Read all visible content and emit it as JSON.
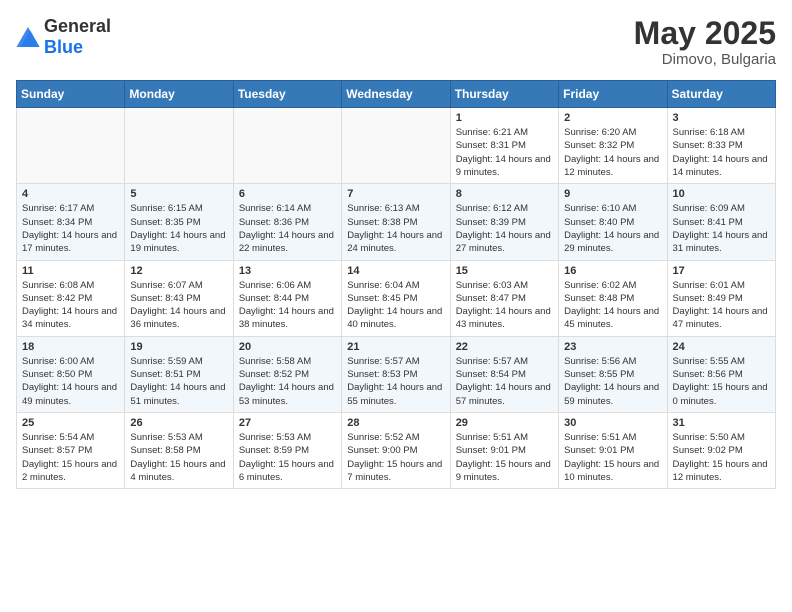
{
  "header": {
    "logo_general": "General",
    "logo_blue": "Blue",
    "month": "May 2025",
    "location": "Dimovo, Bulgaria"
  },
  "weekdays": [
    "Sunday",
    "Monday",
    "Tuesday",
    "Wednesday",
    "Thursday",
    "Friday",
    "Saturday"
  ],
  "weeks": [
    [
      {
        "day": "",
        "sunrise": "",
        "sunset": "",
        "daylight": ""
      },
      {
        "day": "",
        "sunrise": "",
        "sunset": "",
        "daylight": ""
      },
      {
        "day": "",
        "sunrise": "",
        "sunset": "",
        "daylight": ""
      },
      {
        "day": "",
        "sunrise": "",
        "sunset": "",
        "daylight": ""
      },
      {
        "day": "1",
        "sunrise": "Sunrise: 6:21 AM",
        "sunset": "Sunset: 8:31 PM",
        "daylight": "Daylight: 14 hours and 9 minutes."
      },
      {
        "day": "2",
        "sunrise": "Sunrise: 6:20 AM",
        "sunset": "Sunset: 8:32 PM",
        "daylight": "Daylight: 14 hours and 12 minutes."
      },
      {
        "day": "3",
        "sunrise": "Sunrise: 6:18 AM",
        "sunset": "Sunset: 8:33 PM",
        "daylight": "Daylight: 14 hours and 14 minutes."
      }
    ],
    [
      {
        "day": "4",
        "sunrise": "Sunrise: 6:17 AM",
        "sunset": "Sunset: 8:34 PM",
        "daylight": "Daylight: 14 hours and 17 minutes."
      },
      {
        "day": "5",
        "sunrise": "Sunrise: 6:15 AM",
        "sunset": "Sunset: 8:35 PM",
        "daylight": "Daylight: 14 hours and 19 minutes."
      },
      {
        "day": "6",
        "sunrise": "Sunrise: 6:14 AM",
        "sunset": "Sunset: 8:36 PM",
        "daylight": "Daylight: 14 hours and 22 minutes."
      },
      {
        "day": "7",
        "sunrise": "Sunrise: 6:13 AM",
        "sunset": "Sunset: 8:38 PM",
        "daylight": "Daylight: 14 hours and 24 minutes."
      },
      {
        "day": "8",
        "sunrise": "Sunrise: 6:12 AM",
        "sunset": "Sunset: 8:39 PM",
        "daylight": "Daylight: 14 hours and 27 minutes."
      },
      {
        "day": "9",
        "sunrise": "Sunrise: 6:10 AM",
        "sunset": "Sunset: 8:40 PM",
        "daylight": "Daylight: 14 hours and 29 minutes."
      },
      {
        "day": "10",
        "sunrise": "Sunrise: 6:09 AM",
        "sunset": "Sunset: 8:41 PM",
        "daylight": "Daylight: 14 hours and 31 minutes."
      }
    ],
    [
      {
        "day": "11",
        "sunrise": "Sunrise: 6:08 AM",
        "sunset": "Sunset: 8:42 PM",
        "daylight": "Daylight: 14 hours and 34 minutes."
      },
      {
        "day": "12",
        "sunrise": "Sunrise: 6:07 AM",
        "sunset": "Sunset: 8:43 PM",
        "daylight": "Daylight: 14 hours and 36 minutes."
      },
      {
        "day": "13",
        "sunrise": "Sunrise: 6:06 AM",
        "sunset": "Sunset: 8:44 PM",
        "daylight": "Daylight: 14 hours and 38 minutes."
      },
      {
        "day": "14",
        "sunrise": "Sunrise: 6:04 AM",
        "sunset": "Sunset: 8:45 PM",
        "daylight": "Daylight: 14 hours and 40 minutes."
      },
      {
        "day": "15",
        "sunrise": "Sunrise: 6:03 AM",
        "sunset": "Sunset: 8:47 PM",
        "daylight": "Daylight: 14 hours and 43 minutes."
      },
      {
        "day": "16",
        "sunrise": "Sunrise: 6:02 AM",
        "sunset": "Sunset: 8:48 PM",
        "daylight": "Daylight: 14 hours and 45 minutes."
      },
      {
        "day": "17",
        "sunrise": "Sunrise: 6:01 AM",
        "sunset": "Sunset: 8:49 PM",
        "daylight": "Daylight: 14 hours and 47 minutes."
      }
    ],
    [
      {
        "day": "18",
        "sunrise": "Sunrise: 6:00 AM",
        "sunset": "Sunset: 8:50 PM",
        "daylight": "Daylight: 14 hours and 49 minutes."
      },
      {
        "day": "19",
        "sunrise": "Sunrise: 5:59 AM",
        "sunset": "Sunset: 8:51 PM",
        "daylight": "Daylight: 14 hours and 51 minutes."
      },
      {
        "day": "20",
        "sunrise": "Sunrise: 5:58 AM",
        "sunset": "Sunset: 8:52 PM",
        "daylight": "Daylight: 14 hours and 53 minutes."
      },
      {
        "day": "21",
        "sunrise": "Sunrise: 5:57 AM",
        "sunset": "Sunset: 8:53 PM",
        "daylight": "Daylight: 14 hours and 55 minutes."
      },
      {
        "day": "22",
        "sunrise": "Sunrise: 5:57 AM",
        "sunset": "Sunset: 8:54 PM",
        "daylight": "Daylight: 14 hours and 57 minutes."
      },
      {
        "day": "23",
        "sunrise": "Sunrise: 5:56 AM",
        "sunset": "Sunset: 8:55 PM",
        "daylight": "Daylight: 14 hours and 59 minutes."
      },
      {
        "day": "24",
        "sunrise": "Sunrise: 5:55 AM",
        "sunset": "Sunset: 8:56 PM",
        "daylight": "Daylight: 15 hours and 0 minutes."
      }
    ],
    [
      {
        "day": "25",
        "sunrise": "Sunrise: 5:54 AM",
        "sunset": "Sunset: 8:57 PM",
        "daylight": "Daylight: 15 hours and 2 minutes."
      },
      {
        "day": "26",
        "sunrise": "Sunrise: 5:53 AM",
        "sunset": "Sunset: 8:58 PM",
        "daylight": "Daylight: 15 hours and 4 minutes."
      },
      {
        "day": "27",
        "sunrise": "Sunrise: 5:53 AM",
        "sunset": "Sunset: 8:59 PM",
        "daylight": "Daylight: 15 hours and 6 minutes."
      },
      {
        "day": "28",
        "sunrise": "Sunrise: 5:52 AM",
        "sunset": "Sunset: 9:00 PM",
        "daylight": "Daylight: 15 hours and 7 minutes."
      },
      {
        "day": "29",
        "sunrise": "Sunrise: 5:51 AM",
        "sunset": "Sunset: 9:01 PM",
        "daylight": "Daylight: 15 hours and 9 minutes."
      },
      {
        "day": "30",
        "sunrise": "Sunrise: 5:51 AM",
        "sunset": "Sunset: 9:01 PM",
        "daylight": "Daylight: 15 hours and 10 minutes."
      },
      {
        "day": "31",
        "sunrise": "Sunrise: 5:50 AM",
        "sunset": "Sunset: 9:02 PM",
        "daylight": "Daylight: 15 hours and 12 minutes."
      }
    ]
  ]
}
